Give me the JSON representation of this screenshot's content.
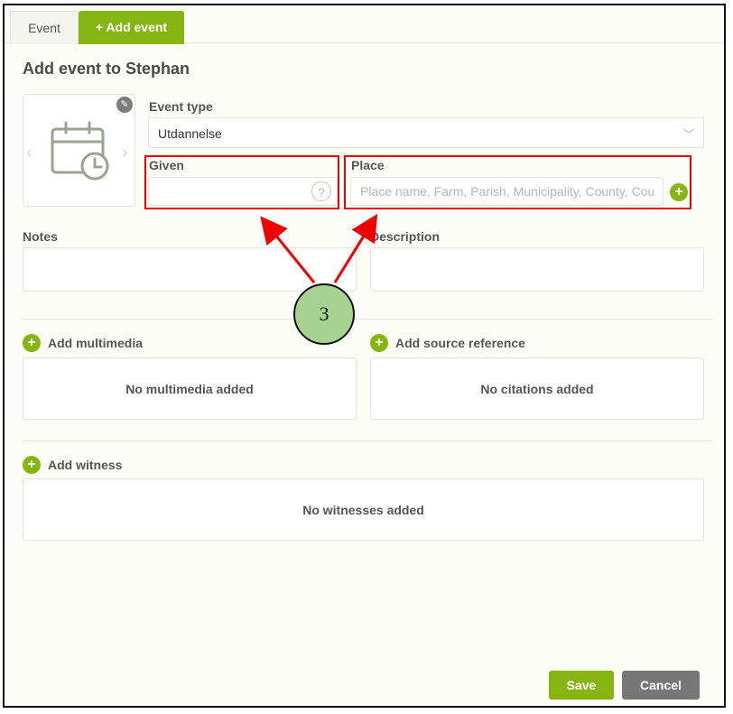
{
  "tabs": [
    {
      "label": "Event"
    },
    {
      "label": "+ Add event"
    }
  ],
  "title": "Add event to Stephan",
  "event_type": {
    "label": "Event type",
    "value": "Utdannelse"
  },
  "given": {
    "label": "Given",
    "help": "?"
  },
  "place": {
    "label": "Place",
    "placeholder": "Place name, Farm, Parish, Municipality, County, Country"
  },
  "notes": {
    "label": "Notes"
  },
  "description": {
    "label": "Description"
  },
  "multimedia": {
    "add_label": "Add multimedia",
    "empty": "No multimedia added"
  },
  "source": {
    "add_label": "Add source reference",
    "empty": "No citations added"
  },
  "witness": {
    "add_label": "Add witness",
    "empty": "No witnesses added"
  },
  "callout": {
    "number": "3"
  },
  "buttons": {
    "save": "Save",
    "cancel": "Cancel"
  },
  "colors": {
    "accent": "#86b512",
    "annotation": "#ee0000",
    "callout": "#a6d38f"
  },
  "icons": {
    "photo": "calendar-clock-icon",
    "edit": "pencil-icon",
    "prev": "chevron-left-icon",
    "next": "chevron-right-icon",
    "dropdown": "chevron-down-icon",
    "add": "plus-icon",
    "help": "question-icon"
  }
}
